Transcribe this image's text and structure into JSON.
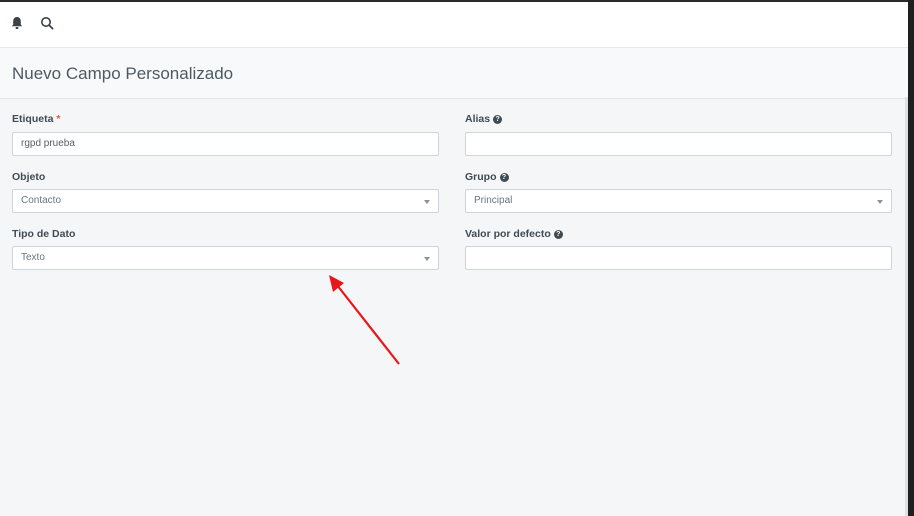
{
  "header": {
    "title": "Nuevo Campo Personalizado"
  },
  "topbar": {
    "icons": [
      "bell-icon",
      "search-icon"
    ]
  },
  "form": {
    "etiqueta": {
      "label": "Etiqueta",
      "required_mark": "*",
      "value": "rgpd prueba"
    },
    "alias": {
      "label": "Alias",
      "value": ""
    },
    "objeto": {
      "label": "Objeto",
      "value": "Contacto"
    },
    "grupo": {
      "label": "Grupo",
      "value": "Principal"
    },
    "tipo_dato": {
      "label": "Tipo de Dato",
      "value": "Texto"
    },
    "valor_defecto": {
      "label": "Valor por defecto",
      "value": ""
    }
  },
  "colors": {
    "annotation_arrow": "#e8161b",
    "required": "#e8554a"
  }
}
